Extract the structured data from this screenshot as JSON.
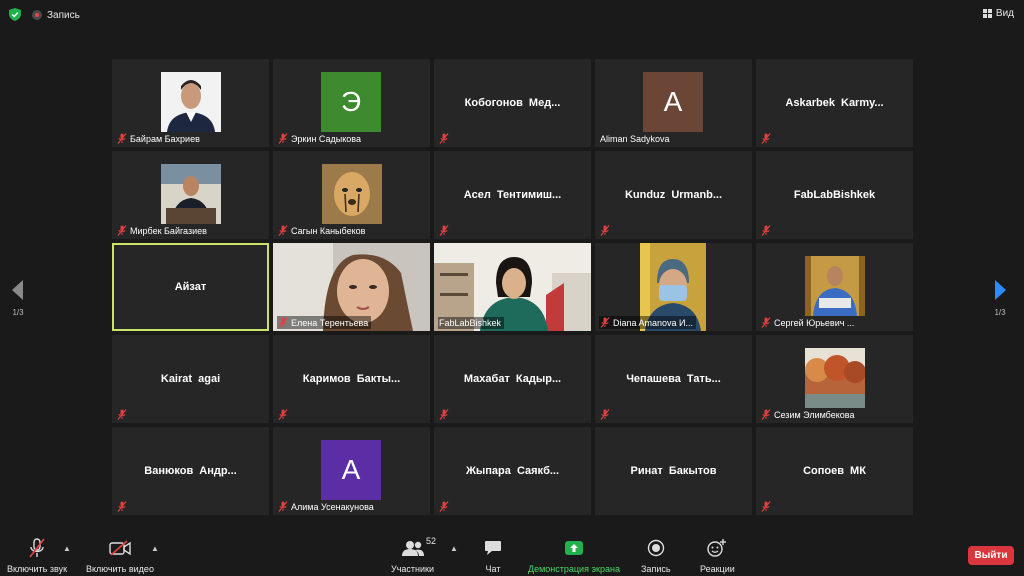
{
  "topbar": {
    "record_label": "Запись",
    "view_label": "Вид"
  },
  "pager": {
    "left_page": "1/3",
    "right_page": "1/3"
  },
  "tiles": [
    {
      "label": "Байрам Бахриев"
    },
    {
      "label": "Эркин Садыкова",
      "avatar_letter": "Э"
    },
    {
      "center_name": "Кобогонов Мед..."
    },
    {
      "label": "Aliman Sadykova",
      "avatar_letter": "A"
    },
    {
      "center_name": "Askarbek Karmy..."
    },
    {
      "label": "Мирбек Байгазиев"
    },
    {
      "label": "Сагын Каныбеков"
    },
    {
      "center_name": "Асел Тентимиш..."
    },
    {
      "center_name": "Kunduz Urmanb..."
    },
    {
      "center_name": "FabLabBishkek"
    },
    {
      "center_name": "Айзат"
    },
    {
      "label": "Елена Терентьева"
    },
    {
      "label": "FabLabBishkek"
    },
    {
      "label": "Diana Amanova И..."
    },
    {
      "label": "Сергей Юрьевич ..."
    },
    {
      "center_name": "Kairat agai"
    },
    {
      "center_name": "Каримов Бакты..."
    },
    {
      "center_name": "Махабат Кадыр..."
    },
    {
      "center_name": "Чепашева Тать..."
    },
    {
      "label": "Сезим Элимбекова"
    },
    {
      "center_name": "Ванюков Андр..."
    },
    {
      "label": "Алима Усенакунова",
      "avatar_letter": "A"
    },
    {
      "center_name": "Жыпара Саякб..."
    },
    {
      "center_name": "Ринат Бакытов"
    },
    {
      "center_name": "Сопоев МК"
    }
  ],
  "toolbar": {
    "unmute_label": "Включить звук",
    "start_video_label": "Включить видео",
    "participants_label": "Участники",
    "participants_count": "52",
    "chat_label": "Чат",
    "share_label": "Демонстрация экрана",
    "record_label": "Запись",
    "reactions_label": "Реакции",
    "leave_label": "Выйти"
  },
  "colors": {
    "background": "#1a1a1a",
    "tile": "#262626",
    "active_border": "#c9e26a",
    "share_green": "#4cd964",
    "leave_red": "#d9363e",
    "nav_arrow_blue": "#2d8cff"
  }
}
